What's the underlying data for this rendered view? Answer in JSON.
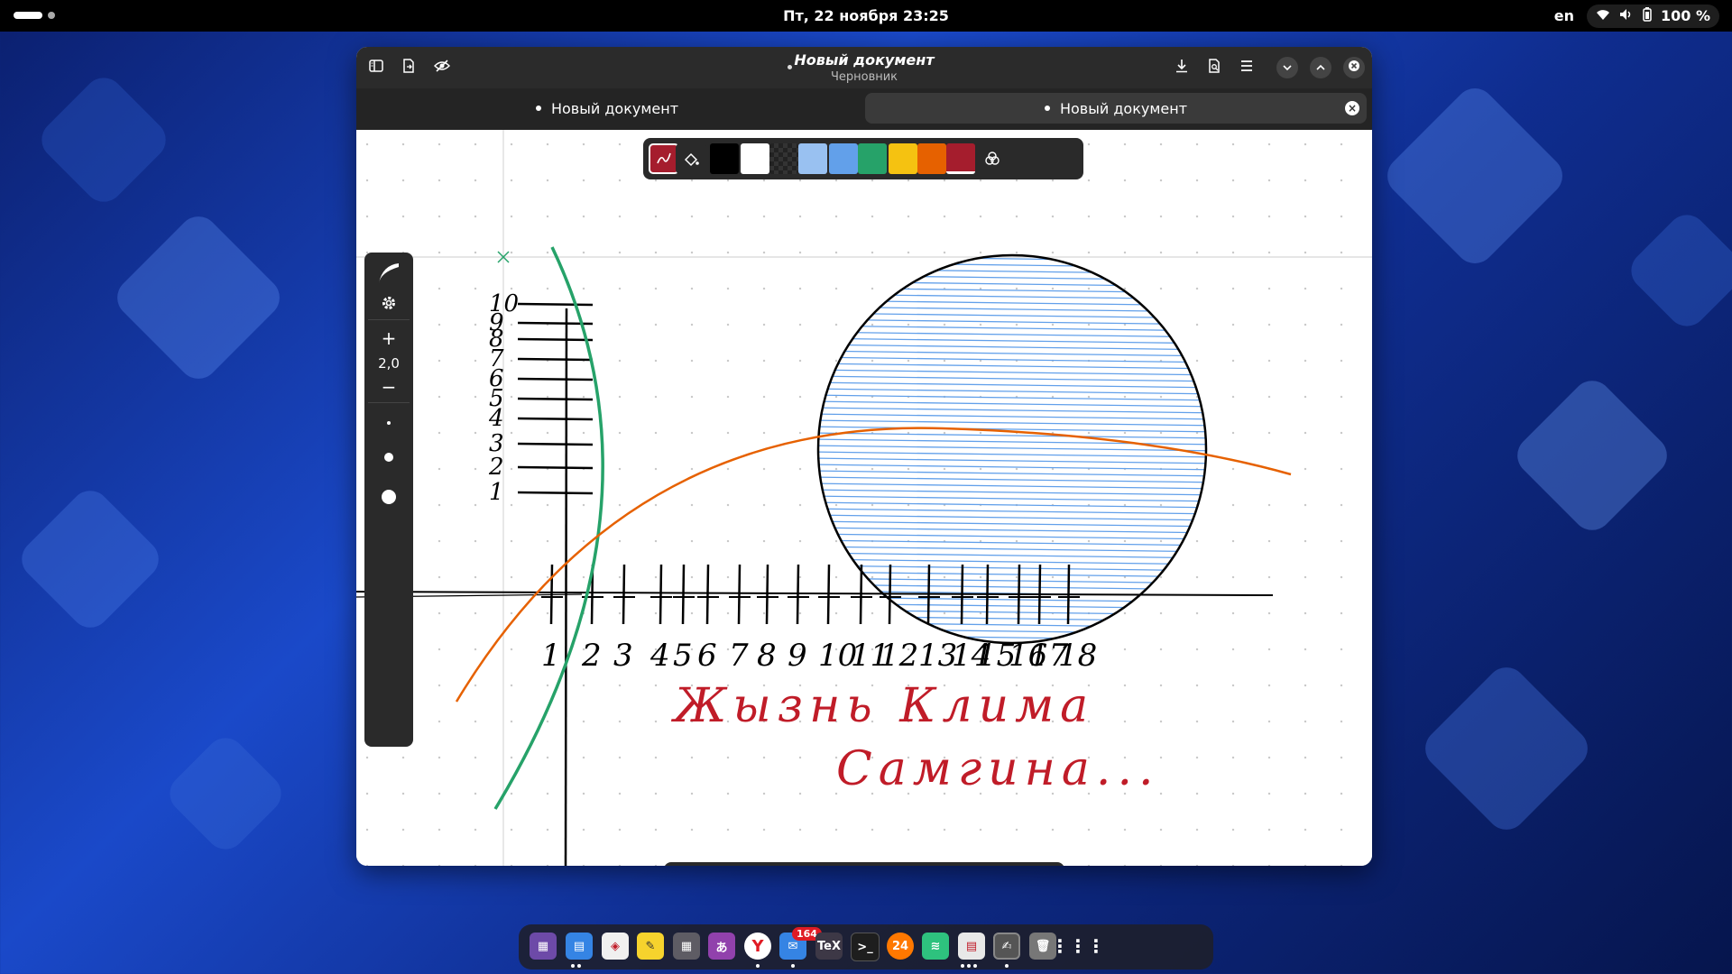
{
  "topbar": {
    "datetime": "Пт, 22 ноября  23:25",
    "keyboard_layout": "en",
    "battery": "100 %"
  },
  "window": {
    "title": "Новый документ",
    "subtitle": "Черновник",
    "tabs": [
      {
        "label": "Новый документ",
        "active": false
      },
      {
        "label": "Новый документ",
        "active": true
      }
    ]
  },
  "palette": {
    "colors": [
      "#000000",
      "#ffffff",
      "#2c2c2c",
      "#99c1f1",
      "#62a0ea",
      "#26a269",
      "#f5c211",
      "#e66100",
      "#a51d2d"
    ]
  },
  "side_panel": {
    "stroke_width": "2,0",
    "plus": "+",
    "minus": "−"
  },
  "drawing": {
    "handwritten_line1": "Жызнь Клима",
    "handwritten_line2": "Самгина...",
    "x_axis_labels": [
      "1",
      "2",
      "3",
      "4",
      "5",
      "6",
      "7",
      "8",
      "9",
      "10",
      "11",
      "12",
      "13",
      "14",
      "15",
      "16",
      "17",
      "18"
    ],
    "y_axis_labels": [
      "10",
      "9",
      "8",
      "7",
      "6",
      "5",
      "4",
      "3",
      "2",
      "1"
    ],
    "colors": {
      "ink": "#000000",
      "green": "#26a269",
      "orange": "#e66100",
      "blue": "#62a0ea",
      "red": "#c01c28"
    }
  },
  "dock": {
    "mail_badge": "164"
  }
}
